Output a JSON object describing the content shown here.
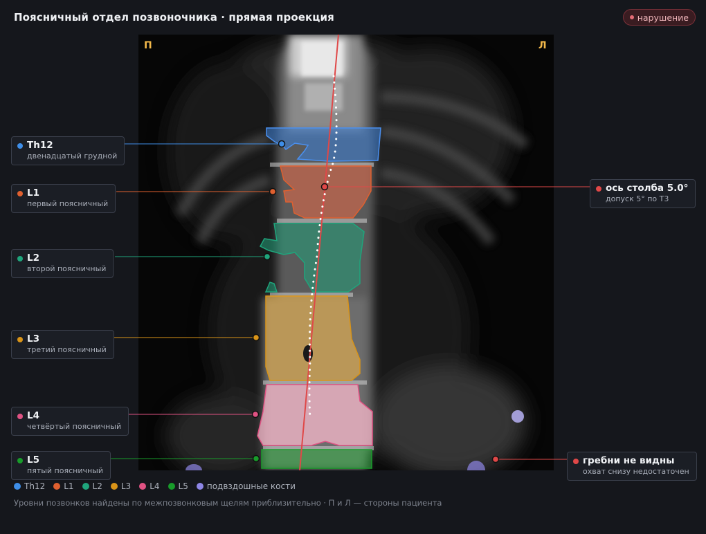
{
  "header": {
    "title": "Поясничный отдел позвоночника · прямая проекция",
    "status_badge": "нарушение"
  },
  "image": {
    "side_right_patient": "П",
    "side_left_patient": "Л"
  },
  "callouts": {
    "th12": {
      "name": "Th12",
      "desc": "двенадцатый грудной",
      "color": "#3e8ee8"
    },
    "l1": {
      "name": "L1",
      "desc": "первый поясничный",
      "color": "#e0602f"
    },
    "l2": {
      "name": "L2",
      "desc": "второй поясничный",
      "color": "#1fa57c"
    },
    "l3": {
      "name": "L3",
      "desc": "третий поясничный",
      "color": "#d99418"
    },
    "l4": {
      "name": "L4",
      "desc": "четвёртый поясничный",
      "color": "#e05283"
    },
    "l5": {
      "name": "L5",
      "desc": "пятый поясничный",
      "color": "#189c2a"
    },
    "axis": {
      "name": "ось столба 5.0°",
      "desc": "допуск 5° по Т3",
      "color": "#e04848"
    },
    "crests": {
      "name": "гребни не видны",
      "desc": "охват снизу недостаточен",
      "color": "#e04848"
    }
  },
  "legend": [
    {
      "label": "Th12",
      "color": "#3e8ee8"
    },
    {
      "label": "L1",
      "color": "#e0602f"
    },
    {
      "label": "L2",
      "color": "#1fa57c"
    },
    {
      "label": "L3",
      "color": "#d99418"
    },
    {
      "label": "L4",
      "color": "#e05283"
    },
    {
      "label": "L5",
      "color": "#189c2a"
    },
    {
      "label": "подвздошные кости",
      "color": "#8e86e6"
    }
  ],
  "footnote": "Уровни позвонков найдены по межпозвонковым щелям приблизительно · П и Л — стороны пациента"
}
